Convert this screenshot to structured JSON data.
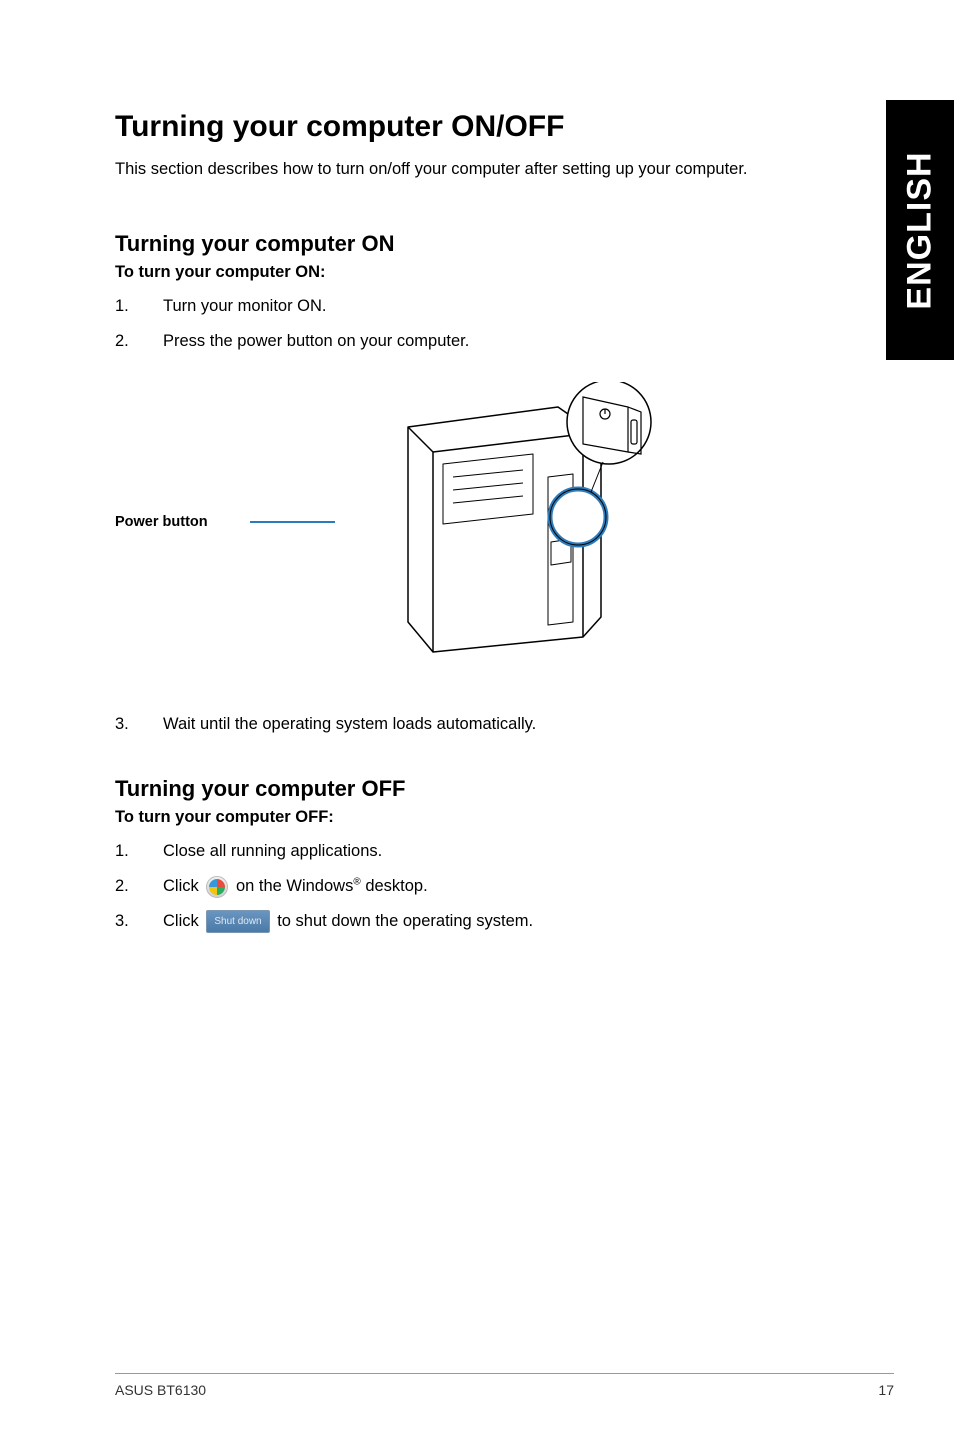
{
  "sideTab": "ENGLISH",
  "title": "Turning your computer ON/OFF",
  "intro": "This section describes how to turn on/off your computer after setting up your computer.",
  "sectionOn": {
    "heading": "Turning your computer ON",
    "subhead": "To turn your computer ON:",
    "steps": [
      {
        "num": "1.",
        "text": "Turn your monitor ON."
      },
      {
        "num": "2.",
        "text": "Press the power button on your computer."
      },
      {
        "num": "3.",
        "text": "Wait until the operating system loads automatically."
      }
    ],
    "figureLabel": "Power button"
  },
  "sectionOff": {
    "heading": "Turning your computer OFF",
    "subhead": "To turn your computer OFF:",
    "steps": [
      {
        "num": "1.",
        "text": "Close all running applications."
      },
      {
        "num": "2.",
        "pre": "Click ",
        "post_pre": " on the Windows",
        "sup": "®",
        "post": " desktop."
      },
      {
        "num": "3.",
        "pre": "Click ",
        "btn": "Shut down",
        "post": " to shut down the operating system."
      }
    ]
  },
  "footer": {
    "left": "ASUS BT6130",
    "right": "17"
  }
}
